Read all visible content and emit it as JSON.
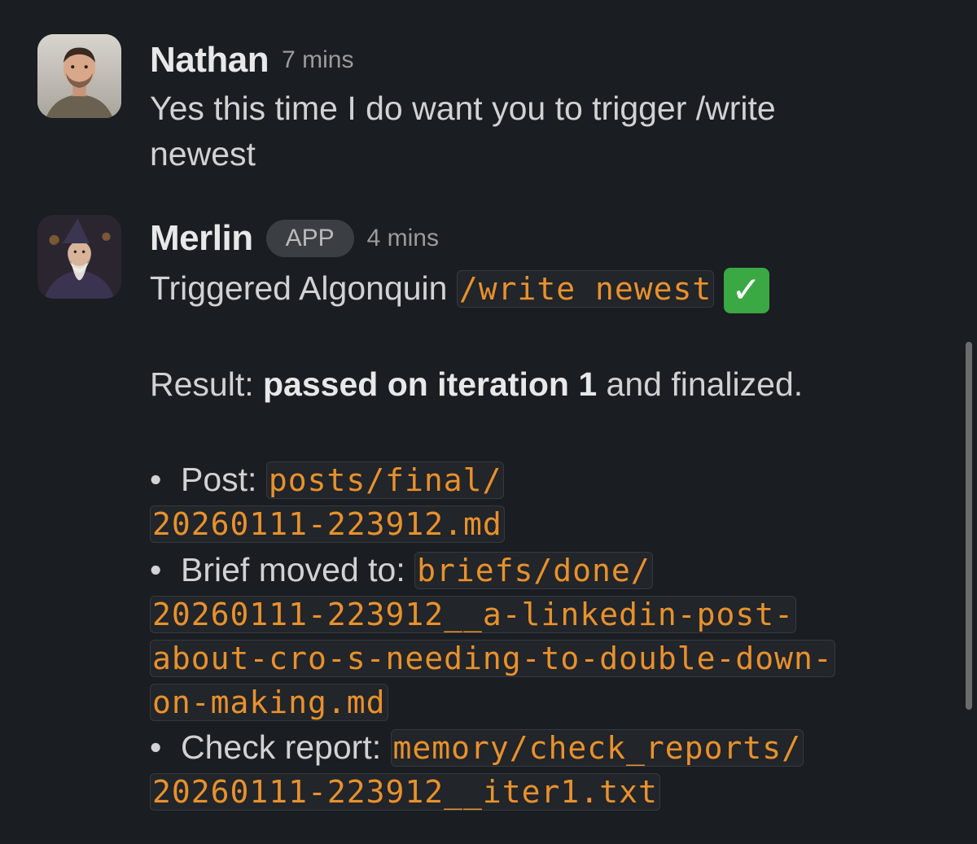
{
  "messages": [
    {
      "author": "Nathan",
      "time": "7 mins",
      "text_line1": "Yes this time I do want you to trigger /write",
      "text_line2": "newest"
    },
    {
      "author": "Merlin",
      "badge": "APP",
      "time": "4 mins",
      "line1_prefix": "Triggered Algonquin",
      "line1_code": "/write newest",
      "line1_emoji": "✓",
      "result_prefix": "Result:",
      "result_bold": "passed on iteration 1",
      "result_suffix": "and finalized.",
      "bullets": [
        {
          "label": "Post:",
          "code_line1": "posts/final/",
          "code_line2": "20260111-223912.md"
        },
        {
          "label": "Brief moved to:",
          "code_line1": "briefs/done/",
          "code_line2": "20260111-223912__a-linkedin-post-",
          "code_line3": "about-cro-s-needing-to-double-down-",
          "code_line4": "on-making.md"
        },
        {
          "label": "Check report:",
          "code_line1": "memory/check_reports/",
          "code_line2": "20260111-223912__iter1.txt"
        }
      ]
    }
  ],
  "bullet_char": "•",
  "colors": {
    "background": "#1a1d21",
    "code_text": "#e8912d",
    "text": "#d1d2d3",
    "check_emoji": "#3aa843"
  }
}
